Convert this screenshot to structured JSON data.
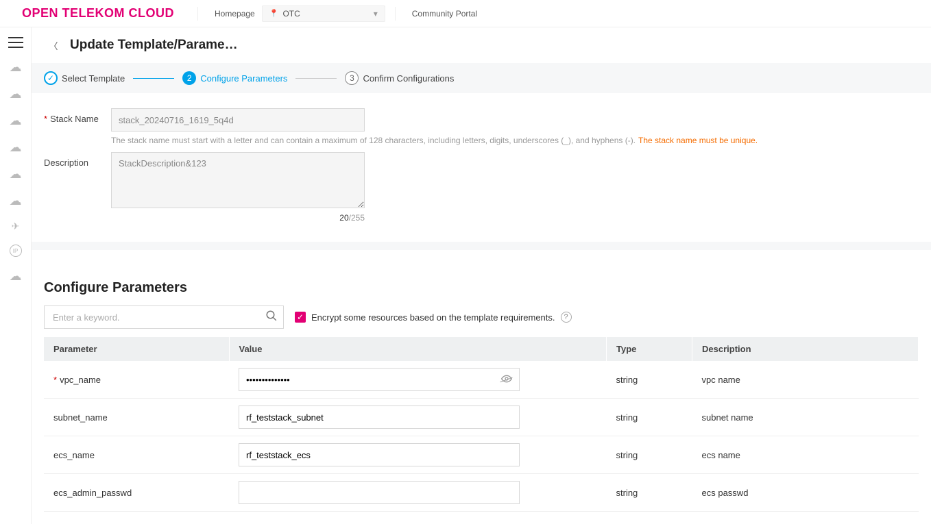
{
  "header": {
    "brand": "OPEN TELEKOM CLOUD",
    "homepage": "Homepage",
    "region": "OTC",
    "community": "Community Portal"
  },
  "page": {
    "title": "Update Template/Parame…"
  },
  "stepper": {
    "step1": "Select Template",
    "step2": "Configure Parameters",
    "step3": "Confirm Configurations",
    "step2_num": "2",
    "step3_num": "3"
  },
  "form": {
    "stack_label": "Stack Name",
    "stack_value": "stack_20240716_1619_5q4d",
    "stack_hint": "The stack name must start with a letter and can contain a maximum of 128 characters, including letters, digits, underscores (_), and hyphens (-). ",
    "stack_unique": "The stack name must be unique.",
    "desc_label": "Description",
    "desc_value": "StackDescription&123",
    "desc_count": "20",
    "desc_max": "/255"
  },
  "section": {
    "title": "Configure Parameters",
    "search_placeholder": "Enter a keyword.",
    "encrypt_label": "Encrypt some resources based on the template requirements."
  },
  "table": {
    "h_param": "Parameter",
    "h_value": "Value",
    "h_type": "Type",
    "h_desc": "Description",
    "rows": [
      {
        "required": true,
        "param": "vpc_name",
        "value": "••••••••••••••",
        "masked": true,
        "type": "string",
        "desc": "vpc name"
      },
      {
        "required": false,
        "param": "subnet_name",
        "value": "rf_teststack_subnet",
        "masked": false,
        "type": "string",
        "desc": "subnet name"
      },
      {
        "required": false,
        "param": "ecs_name",
        "value": "rf_teststack_ecs",
        "masked": false,
        "type": "string",
        "desc": "ecs name"
      },
      {
        "required": false,
        "param": "ecs_admin_passwd",
        "value": "",
        "masked": false,
        "type": "string",
        "desc": "ecs passwd"
      }
    ]
  }
}
